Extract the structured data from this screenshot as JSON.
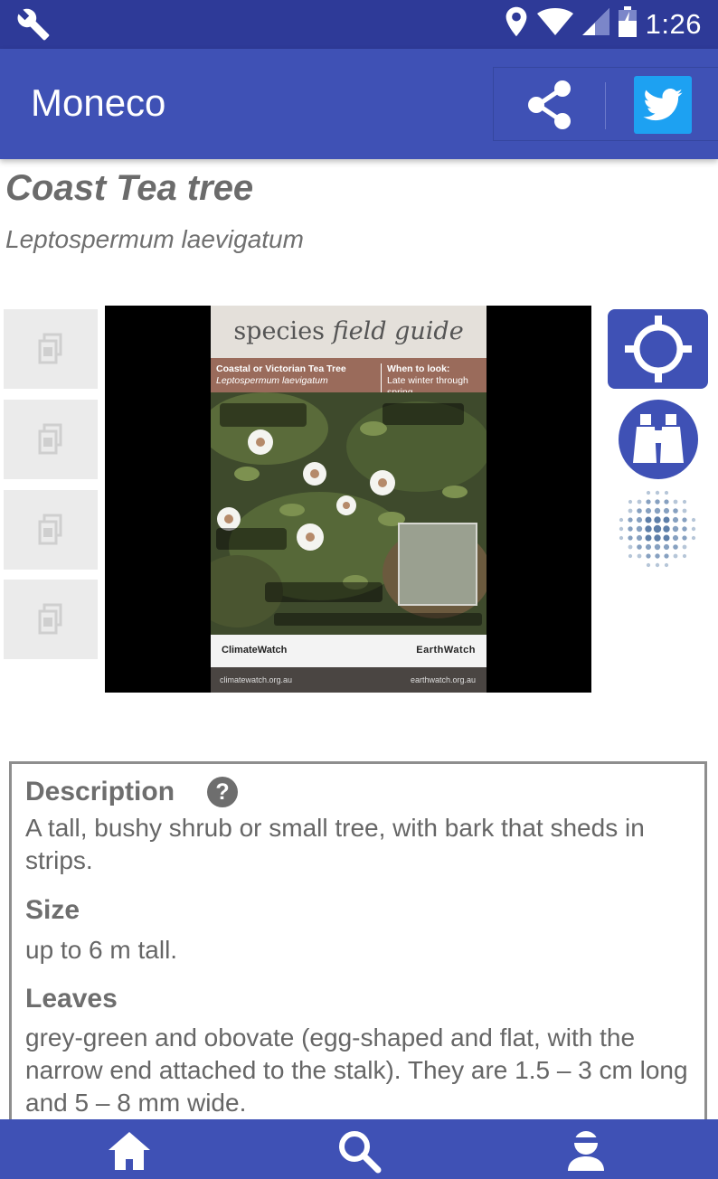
{
  "status_bar": {
    "time": "1:26",
    "icons": [
      "wrench-icon",
      "location-icon",
      "wifi-icon",
      "signal-icon",
      "battery-icon"
    ]
  },
  "app_bar": {
    "title": "Moneco",
    "actions": [
      "share-icon",
      "twitter-icon"
    ]
  },
  "species": {
    "common_name": "Coast Tea tree",
    "scientific_name": "Leptospermum laevigatum"
  },
  "gallery": {
    "thumbnail_count": 4,
    "poster": {
      "header_left": "species",
      "header_right": "field guide",
      "band_title": "Coastal or Victorian Tea Tree",
      "band_subtitle": "Leptospermum laevigatum",
      "band_right_title": "When to look:",
      "band_right_text": "Late winter through spring",
      "footer_left": "ClimateWatch",
      "footer_right": "EarthWatch",
      "url_left": "climatewatch.org.au",
      "url_right": "earthwatch.org.au"
    }
  },
  "side_actions": [
    "crosshair-target-icon",
    "binoculars-icon",
    "dots-pattern-icon"
  ],
  "details": {
    "description_heading": "Description",
    "description_text": "A tall, bushy shrub or small tree, with bark that sheds in strips.",
    "size_heading": "Size",
    "size_text": "up to 6 m tall.",
    "leaves_heading": "Leaves",
    "leaves_text": "grey-green and obovate (egg-shaped and flat, with the narrow end attached to the stalk). They are 1.5 – 3 cm long and 5 – 8 mm wide."
  },
  "bottom_nav": [
    "home-icon",
    "search-icon",
    "profile-icon"
  ],
  "colors": {
    "primary": "#3f51b5",
    "status_bar": "#2e3a98",
    "twitter": "#1da1f2",
    "text_grey": "#6e6e6e"
  }
}
